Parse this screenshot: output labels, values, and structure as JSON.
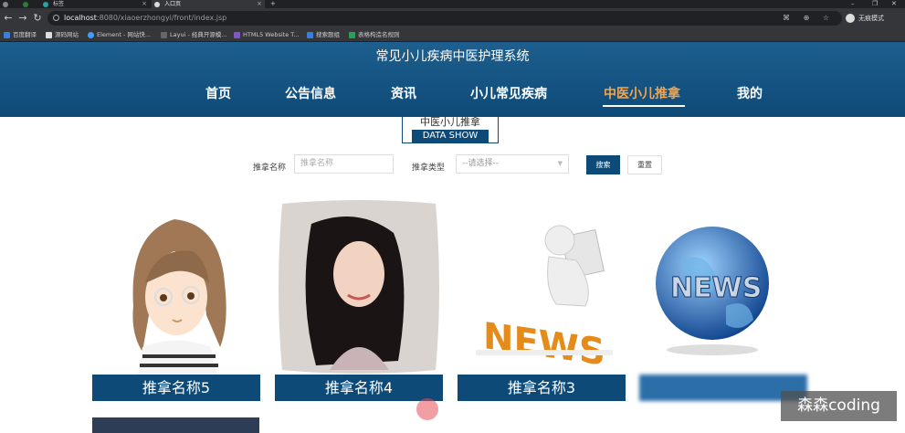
{
  "browser": {
    "tabs": [
      {
        "title": "",
        "active": false
      },
      {
        "title": "",
        "active": false
      },
      {
        "title": "标签",
        "active": false
      },
      {
        "title": "入口页",
        "active": true
      }
    ],
    "url_host": "localhost",
    "url_path": ":8080/xiaoerzhongyi/front/index.jsp",
    "profile_label": "无痕模式",
    "bookmarks": [
      "百度翻译",
      "源码网站",
      "Element - 网站快...",
      "Layui - 经典开源模...",
      "HTML5 Website T...",
      "搜索题组",
      "表格构造名规则"
    ]
  },
  "header": {
    "site_title": "常见小儿疾病中医护理系统",
    "menu": [
      "首页",
      "公告信息",
      "资讯",
      "小儿常见疾病",
      "中医小儿推拿",
      "我的"
    ],
    "active_menu": "中医小儿推拿"
  },
  "section": {
    "title_cn": "中医小儿推拿",
    "title_en": "DATA SHOW"
  },
  "search": {
    "name_label": "推拿名称",
    "name_placeholder": "推拿名称",
    "type_label": "推拿类型",
    "type_value": "--请选择--",
    "search_button": "搜索",
    "reset_button": "重置"
  },
  "cards": [
    {
      "caption": "推拿名称5",
      "image": "cartoon-girl-glasses"
    },
    {
      "caption": "推拿名称4",
      "image": "woman-portrait-pillow"
    },
    {
      "caption": "推拿名称3",
      "image": "news-reading-figure"
    },
    {
      "caption": "",
      "image": "news-globe"
    }
  ],
  "watermark": "森森coding",
  "colors": {
    "primary": "#0e4a78",
    "active_menu": "#f3a54e"
  }
}
